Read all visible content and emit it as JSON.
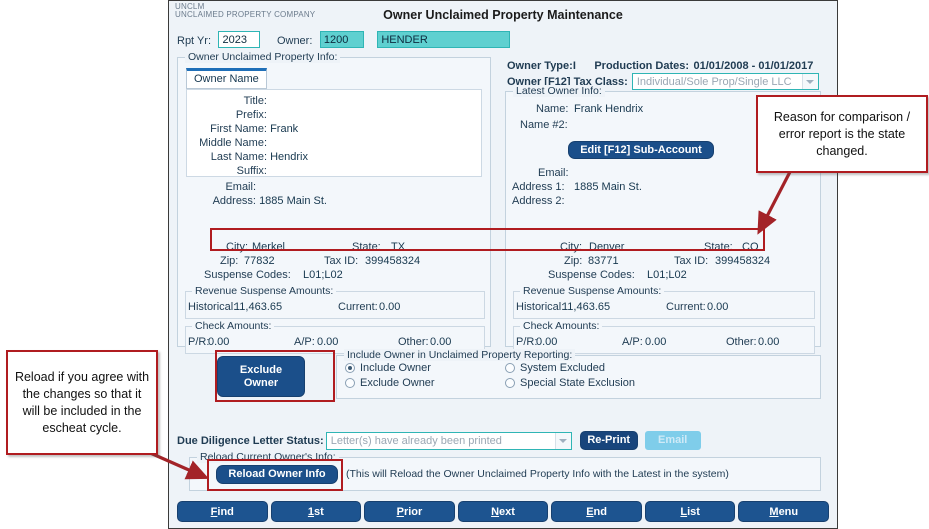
{
  "window": {
    "brand_code": "UNCLM",
    "brand_name": "UNCLAIMED PROPERTY COMPANY",
    "title": "Owner Unclaimed Property Maintenance"
  },
  "toprow": {
    "rpt_yr_label": "Rpt Yr:",
    "rpt_yr_value": "2023",
    "owner_label": "Owner:",
    "owner_number": "1200",
    "owner_name": "HENDER"
  },
  "left_panel": {
    "group_title": "Owner Unclaimed Property Info:",
    "tab_label": "Owner Name",
    "name_fields": [
      {
        "label": "Title:",
        "value": ""
      },
      {
        "label": "Prefix:",
        "value": ""
      },
      {
        "label": "First Name:",
        "value": "Frank"
      },
      {
        "label": "Middle Name:",
        "value": ""
      },
      {
        "label": "Last Name:",
        "value": "Hendrix"
      },
      {
        "label": "Suffix:",
        "value": ""
      }
    ],
    "email_label": "Email:",
    "email_value": "",
    "address_label": "Address:",
    "address_value": "1885 Main St.",
    "city_label": "City:",
    "city_value": "Merkel",
    "state_label": "State:",
    "state_value": "TX",
    "zip_label": "Zip:",
    "zip_value": "77832",
    "taxid_label": "Tax ID:",
    "taxid_value": "399458324",
    "suspense_label": "Suspense Codes:",
    "suspense_value": "L01;L02",
    "revenue_group": "Revenue Suspense Amounts:",
    "historical_label": "Historical:",
    "historical_value": "11,463.65",
    "current_label": "Current:",
    "current_value": "0.00",
    "check_group": "Check Amounts:",
    "pr_label": "P/R:",
    "pr_value": "0.00",
    "ap_label": "A/P:",
    "ap_value": "0.00",
    "other_label": "Other:",
    "other_value": "0.00"
  },
  "right_panel": {
    "owner_type_label": "Owner Type:",
    "owner_type_value": "I",
    "production_dates_label": "Production Dates:",
    "production_dates_value": "01/01/2008 - 01/01/2017",
    "tax_class_label": "Owner [F12] Tax Class:",
    "tax_class_value": "Individual/Sole Prop/Single LLC",
    "group_title": "Latest Owner Info:",
    "name_label": "Name:",
    "name_value": "Frank Hendrix",
    "name2_label": "Name #2:",
    "name2_value": "",
    "sub_account_button": "Edit [F12] Sub-Account",
    "email_label": "Email:",
    "email_value": "",
    "address1_label": "Address 1:",
    "address1_value": "1885 Main St.",
    "address2_label": "Address 2:",
    "address2_value": "",
    "city_label": "City:",
    "city_value": "Denver",
    "state_label": "State:",
    "state_value": "CO",
    "zip_label": "Zip:",
    "zip_value": "83771",
    "taxid_label": "Tax ID:",
    "taxid_value": "399458324",
    "suspense_label": "Suspense Codes:",
    "suspense_value": "L01;L02",
    "revenue_group": "Revenue Suspense Amounts:",
    "historical_label": "Historical:",
    "historical_value": "11,463.65",
    "current_label": "Current:",
    "current_value": "0.00",
    "check_group": "Check Amounts:",
    "pr_label": "P/R:",
    "pr_value": "0.00",
    "ap_label": "A/P:",
    "ap_value": "0.00",
    "other_label": "Other:",
    "other_value": "0.00"
  },
  "exclude": {
    "button_line1": "Exclude",
    "button_line2": "Owner"
  },
  "reporting": {
    "group_title": "Include Owner in Unclaimed Property Reporting:",
    "options": [
      {
        "label": "Include Owner",
        "selected": true
      },
      {
        "label": "Exclude Owner",
        "selected": false
      },
      {
        "label": "System Excluded",
        "selected": false
      },
      {
        "label": "Special State Exclusion",
        "selected": false
      }
    ]
  },
  "letter": {
    "status_label": "Due Diligence Letter Status:",
    "status_value": "Letter(s) have already been printed",
    "reprint_button": "Re-Print",
    "email_button": "Email"
  },
  "reload": {
    "group_title": "Reload Current Owner's Info:",
    "button_label": "Reload Owner Info",
    "hint": "(This will Reload the Owner Unclaimed Property Info with the Latest in the system)"
  },
  "navbar": {
    "buttons": [
      {
        "accel": "F",
        "rest": "ind"
      },
      {
        "accel": "1",
        "rest": "st"
      },
      {
        "accel": "P",
        "rest": "rior"
      },
      {
        "accel": "N",
        "rest": "ext"
      },
      {
        "accel": "E",
        "rest": "nd"
      },
      {
        "accel": "L",
        "rest": "ist"
      },
      {
        "accel": "M",
        "rest": "enu"
      }
    ]
  },
  "annotations": {
    "state_note": "Reason for comparison / error report is the state changed.",
    "reload_note": "Reload if you agree with the changes so that it will be included in the escheat cycle.",
    "callout_border_color": "#b01c20"
  }
}
